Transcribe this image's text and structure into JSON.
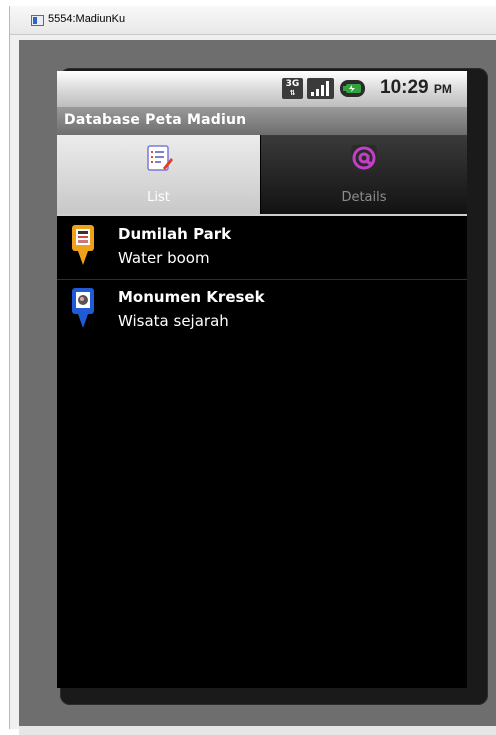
{
  "window": {
    "title": "5554:MadiunKu"
  },
  "status_bar": {
    "network": "3G",
    "time": "10:29",
    "ampm": "PM"
  },
  "app": {
    "title": "Database Peta Madiun"
  },
  "tabs": [
    {
      "label": "List",
      "icon": "list-edit-icon",
      "selected": true
    },
    {
      "label": "Details",
      "icon": "at-sign-icon",
      "selected": false
    }
  ],
  "list": [
    {
      "title": "Dumilah Park",
      "subtitle": "Water boom",
      "pin_color": "#f0a11a",
      "icon": "park-pin-icon"
    },
    {
      "title": "Monumen Kresek",
      "subtitle": "Wisata sejarah",
      "pin_color": "#1f5bd6",
      "icon": "monument-pin-icon"
    }
  ],
  "colors": {
    "emulator_bg": "#6e6e6e",
    "screen_bg": "#000000",
    "selected_tab": "#d9d9d9"
  }
}
